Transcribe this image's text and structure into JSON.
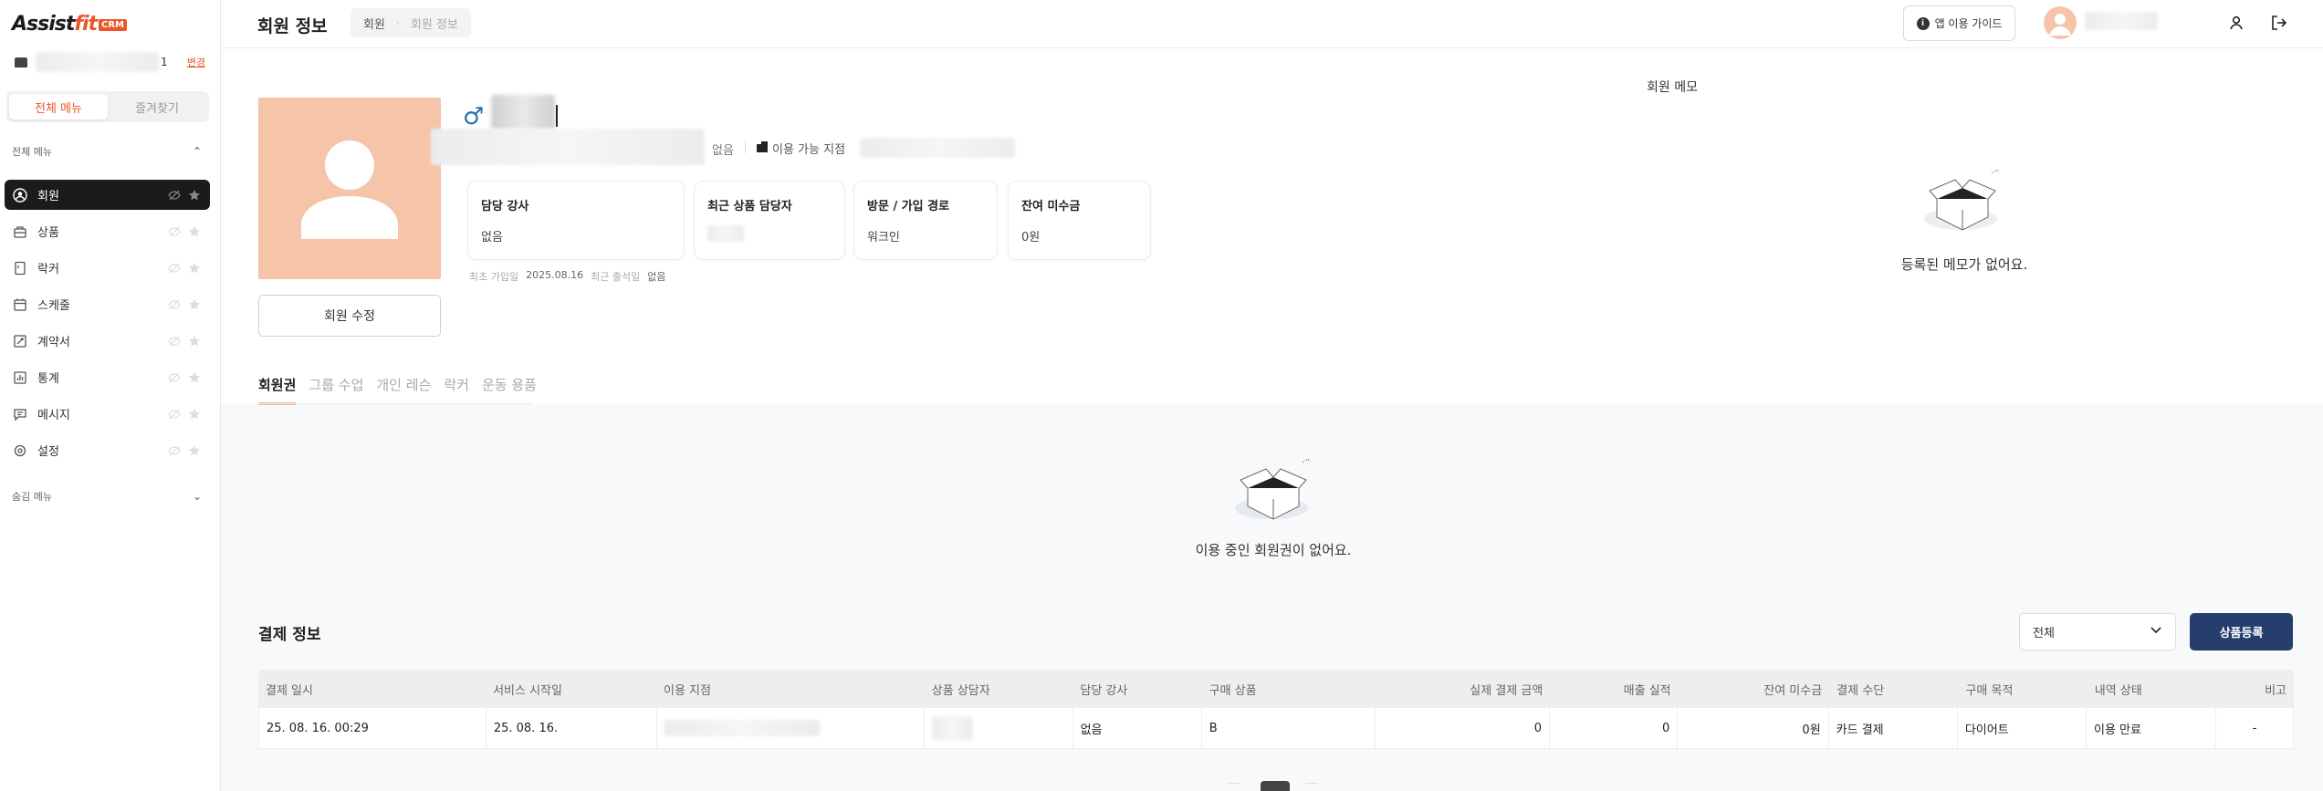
{
  "brand": {
    "logo_main": "Assist",
    "logo_accent": "fit",
    "logo_badge": "CRM"
  },
  "sidebar": {
    "branch_suffix": "1",
    "change_link": "변경",
    "toggle": {
      "all_menu": "전체 메뉴",
      "favorites": "즐겨찾기"
    },
    "all_menu_heading": "전체 메뉴",
    "hidden_menu_heading": "숨김 메뉴",
    "items": [
      {
        "label": "회원",
        "icon": "user-circle-icon",
        "active": true
      },
      {
        "label": "상품",
        "icon": "product-box-icon"
      },
      {
        "label": "락커",
        "icon": "locker-icon"
      },
      {
        "label": "스케줄",
        "icon": "calendar-icon"
      },
      {
        "label": "계약서",
        "icon": "contract-icon"
      },
      {
        "label": "통계",
        "icon": "bar-chart-icon"
      },
      {
        "label": "메시지",
        "icon": "message-icon"
      },
      {
        "label": "설정",
        "icon": "gear-icon"
      }
    ]
  },
  "header": {
    "title": "회원 정보",
    "breadcrumb": [
      "회원",
      "회원 정보"
    ],
    "guide_button": "앱 이용 가이드"
  },
  "member": {
    "gender_symbol": "♂",
    "instructor_none": "없음",
    "available_branch_label": "이용 가능 지점",
    "edit_button": "회원 수정",
    "cards": [
      {
        "label": "담당 강사",
        "value": "없음"
      },
      {
        "label": "최근 상품 담당자",
        "value": ""
      },
      {
        "label": "방문 / 가입 경로",
        "value": "워크인"
      },
      {
        "label": "잔여 미수금",
        "value": "0원"
      }
    ],
    "first_visit_label": "최초 가입일",
    "first_visit_value": "2025.08.16",
    "last_attend_label": "최근 출석일",
    "last_attend_value": "없음"
  },
  "memo": {
    "title": "회원 메모",
    "empty_text": "등록된 메모가 없어요."
  },
  "tabs": [
    "회원권",
    "그룹 수업",
    "개인 레슨",
    "락커",
    "운동 용품"
  ],
  "membership_empty_text": "이용 중인 회원권이 없어요.",
  "payment": {
    "title": "결제 정보",
    "filter_value": "전체",
    "register_button": "상품등록",
    "columns": [
      "결제 일시",
      "서비스 시작일",
      "이용 지점",
      "상품 상담자",
      "담당 강사",
      "구매 상품",
      "실제 결제 금액",
      "매출 실적",
      "잔여 미수금",
      "결제 수단",
      "구매 목적",
      "내역 상태",
      "비고"
    ],
    "rows": [
      {
        "paid_at": "25. 08. 16. 00:29",
        "service_start": "25. 08. 16.",
        "branch": "",
        "consultant": "",
        "instructor": "없음",
        "product": "B",
        "actual_amount": "0",
        "sales": "0",
        "unpaid": "0원",
        "method": "카드 결제",
        "purpose": "다이어트",
        "status": "이용 만료",
        "note": "-"
      }
    ]
  },
  "colors": {
    "accent": "#e8562a",
    "photo_bg": "#f5c4a9",
    "primary_button": "#253e6b",
    "sidebar_active": "#1b1b1b"
  }
}
